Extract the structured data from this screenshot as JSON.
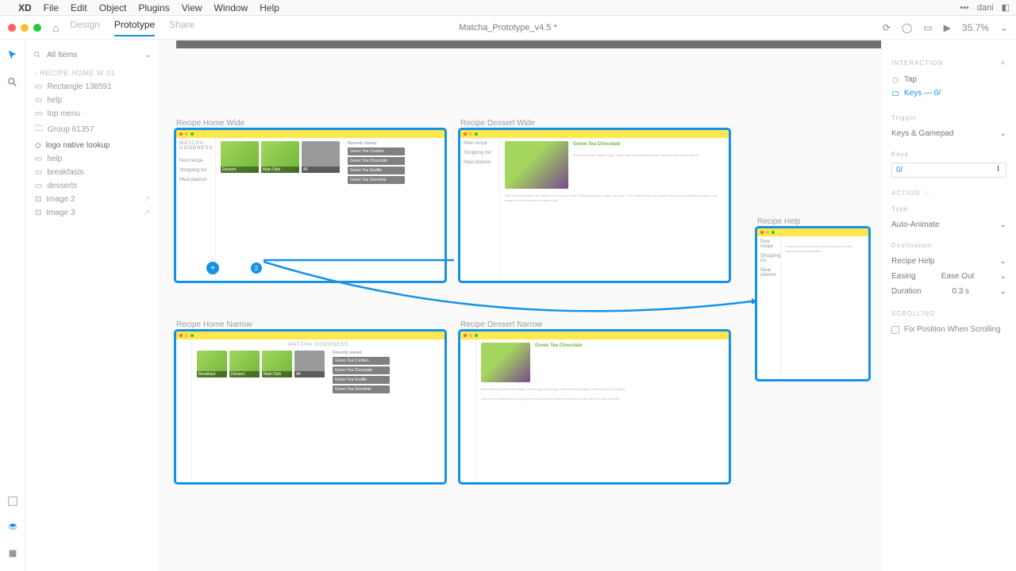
{
  "menubar": {
    "app": "XD",
    "items": [
      "File",
      "Edit",
      "Object",
      "Plugins",
      "View",
      "Window",
      "Help"
    ],
    "user": "dani",
    "ellipsis": "•••"
  },
  "toolbar": {
    "tabs": {
      "design": "Design",
      "prototype": "Prototype",
      "share": "Share"
    },
    "title": "Matcha_Prototype_v4.5 *",
    "zoom": "35.7%"
  },
  "left": {
    "search": "All Items",
    "crumb": "‹  RECIPE HOME W 01",
    "items": [
      {
        "icon": "rect",
        "label": "Rectangle 138591"
      },
      {
        "icon": "rect",
        "label": "help"
      },
      {
        "icon": "rect",
        "label": "top menu"
      },
      {
        "icon": "folder",
        "label": "Group 61357"
      },
      {
        "icon": "diamond",
        "label": "logo native lookup",
        "sel": true
      },
      {
        "icon": "rect",
        "label": "help"
      },
      {
        "icon": "rect",
        "label": "breakfasts"
      },
      {
        "icon": "rect",
        "label": "desserts"
      },
      {
        "icon": "img",
        "label": "Image 2",
        "trail": true
      },
      {
        "icon": "img",
        "label": "Image 3",
        "trail": true
      }
    ]
  },
  "artboards": {
    "homeWide": "Recipe Home Wide",
    "dessertWide": "Recipe Dessert Wide",
    "homeNarrow": "Recipe Home Narrow",
    "dessertNarrow": "Recipe Dessert Narrow",
    "help": "Recipe Help",
    "brand": "MATCHA GOODNESS",
    "sideItems": [
      "New recipe",
      "Shopping list",
      "Meal planner"
    ],
    "tileCaps": [
      "Breakfast",
      "Dessert",
      "Main Dish",
      "All"
    ],
    "recent": "Recently viewed",
    "recList": [
      "Green Tea Cookies",
      "Green Tea Chocolate",
      "Green Tea Souffle",
      "Green Tea Smoothie"
    ],
    "detailTitle": "Green Tea Chocolate"
  },
  "badge": "2",
  "right": {
    "section": "INTERACTION",
    "triggers": [
      {
        "icon": "tap",
        "label": "Tap"
      },
      {
        "icon": "key",
        "label": "Keys — 0/"
      }
    ],
    "triggerH": "Trigger",
    "triggerVal": "Keys & Gamepad",
    "keysH": "Keys",
    "keysVal": "0/",
    "actionH": "ACTION",
    "typeH": "Type",
    "typeVal": "Auto-Animate",
    "destH": "Destination",
    "destVal": "Recipe Help",
    "easeH": "Easing",
    "easeVal": "Ease Out",
    "durH": "Duration",
    "durVal": "0.3 s",
    "scrollH": "SCROLLING",
    "fixpos": "Fix Position When Scrolling"
  }
}
